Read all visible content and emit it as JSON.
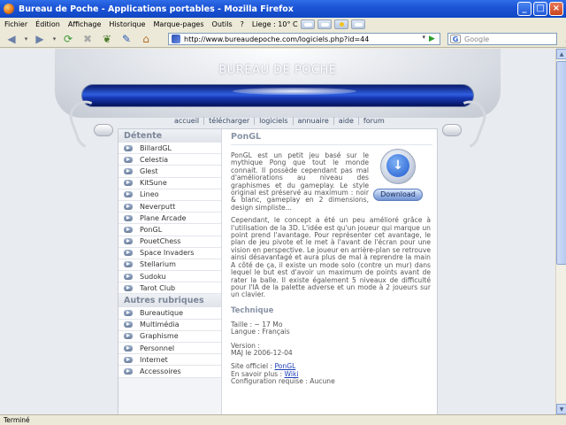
{
  "window": {
    "title": "Bureau de Poche - Applications portables - Mozilla Firefox",
    "minimize": "_",
    "maximize": "□",
    "close": "×"
  },
  "menu": {
    "items": [
      "Fichier",
      "Édition",
      "Affichage",
      "Historique",
      "Marque-pages",
      "Outils",
      "?"
    ],
    "weather": "Liege : 10° C"
  },
  "toolbar": {
    "url": "http://www.bureaudepoche.com/logiciels.php?id=44",
    "search_placeholder": "Google"
  },
  "site": {
    "title": "BUREAU DE POCHE",
    "nav": [
      "accueil",
      "télécharger",
      "logiciels",
      "annuaire",
      "aide",
      "forum"
    ],
    "sidebar": {
      "section1": "Détente",
      "items1": [
        "BillardGL",
        "Celestia",
        "Glest",
        "KitSune",
        "Lineo",
        "Neverputt",
        "Plane Arcade",
        "PonGL",
        "PouetChess",
        "Space Invaders",
        "Stellarium",
        "Sudoku",
        "Tarot Club"
      ],
      "section2": "Autres rubriques",
      "items2": [
        "Bureautique",
        "Multimédia",
        "Graphisme",
        "Personnel",
        "Internet",
        "Accessoires"
      ]
    },
    "content": {
      "title": "PonGL",
      "desc1": "PonGL est un petit jeu basé sur le mythique Pong que tout le monde connait. Il possède cependant pas mal d'améliorations au niveau des graphismes et du gameplay. Le style original est préservé au maximum : noir & blanc, gameplay en 2 dimensions, design simpliste...",
      "desc2": "Cependant, le concept a été un peu amélioré grâce à l'utilisation de la 3D. L'idée est qu'un joueur qui marque un point prend l'avantage. Pour représenter cet avantage, le plan de jeu pivote et le met à l'avant de l'écran pour une vision en perspective. Le joueur en arrière-plan se retrouve ainsi désavantagé et aura plus de mal à reprendre la main A côté de ça, il existe un mode solo (contre un mur) dans lequel le but est d'avoir un maximum de points avant de rater la balle. Il existe également 5 niveaux de difficulté pour l'IA de la palette adverse et un mode à 2 joueurs sur un clavier.",
      "download_label": "Download",
      "tech_title": "Technique",
      "size": "Taille : ~ 17 Mo",
      "language": "Langue : Français",
      "version_label": "Version :",
      "version_value": "MAJ le 2006-12-04",
      "official_label": "Site officiel :",
      "official_link": "PonGL",
      "more_label": "En savoir plus :",
      "more_link": "Wiki",
      "config": "Configuration requise : Aucune"
    }
  },
  "status": "Terminé"
}
